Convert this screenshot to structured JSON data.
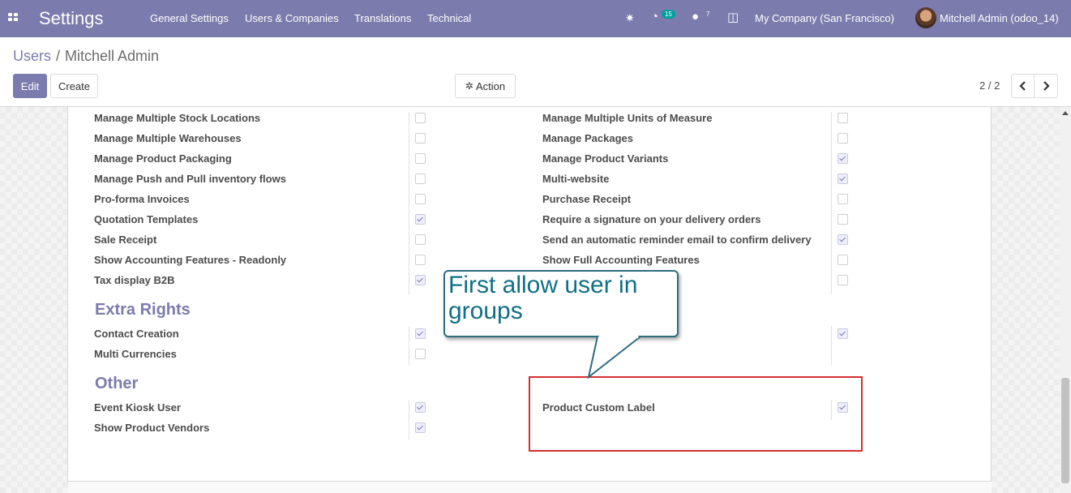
{
  "navbar": {
    "app_title": "Settings",
    "menus": [
      "General Settings",
      "Users & Companies",
      "Translations",
      "Technical"
    ],
    "activity_count": "15",
    "message_count": "7",
    "company": "My Company (San Francisco)",
    "user": "Mitchell Admin (odoo_14)"
  },
  "breadcrumb": {
    "parent": "Users",
    "separator": "/",
    "current": "Mitchell Admin"
  },
  "toolbar": {
    "edit": "Edit",
    "create": "Create",
    "action": "Action",
    "pager": "2 / 2"
  },
  "groups": {
    "left": [
      {
        "label": "Manage Multiple Stock Locations",
        "checked": false
      },
      {
        "label": "Manage Multiple Warehouses",
        "checked": false
      },
      {
        "label": "Manage Product Packaging",
        "checked": false
      },
      {
        "label": "Manage Push and Pull inventory flows",
        "checked": false
      },
      {
        "label": "Pro-forma Invoices",
        "checked": false
      },
      {
        "label": "Quotation Templates",
        "checked": true
      },
      {
        "label": "Sale Receipt",
        "checked": false
      },
      {
        "label": "Show Accounting Features - Readonly",
        "checked": false
      },
      {
        "label": "Tax display B2B",
        "checked": true
      }
    ],
    "right": [
      {
        "label": "Manage Multiple Units of Measure",
        "checked": false
      },
      {
        "label": "Manage Packages",
        "checked": false
      },
      {
        "label": "Manage Product Variants",
        "checked": true
      },
      {
        "label": "Multi-website",
        "checked": true
      },
      {
        "label": "Purchase Receipt",
        "checked": false
      },
      {
        "label": "Require a signature on your delivery orders",
        "checked": false
      },
      {
        "label": "Send an automatic reminder email to confirm delivery",
        "checked": true
      },
      {
        "label": "Show Full Accounting Features",
        "checked": false
      },
      {
        "label": "",
        "checked": false
      }
    ]
  },
  "extra_rights": {
    "title": "Extra Rights",
    "left": [
      {
        "label": "Contact Creation",
        "checked": true
      },
      {
        "label": "Multi Currencies",
        "checked": false
      }
    ],
    "right": [
      {
        "label": "",
        "checked": true
      }
    ]
  },
  "other": {
    "title": "Other",
    "left": [
      {
        "label": "Event Kiosk User",
        "checked": true
      },
      {
        "label": "Show Product Vendors",
        "checked": true
      }
    ],
    "right": [
      {
        "label": "Product Custom Label",
        "checked": true
      }
    ]
  },
  "callout": {
    "text": "First allow user in groups"
  },
  "colors": {
    "navbar": "#7c7bad",
    "section": "#7c7bad",
    "callout_text": "#106f86",
    "highlight": "#d32f2f"
  },
  "icons": [
    "apps-icon",
    "bug-icon",
    "clock-icon",
    "chat-icon",
    "gift-icon",
    "gear-icon",
    "chevron-left-icon",
    "chevron-right-icon"
  ]
}
